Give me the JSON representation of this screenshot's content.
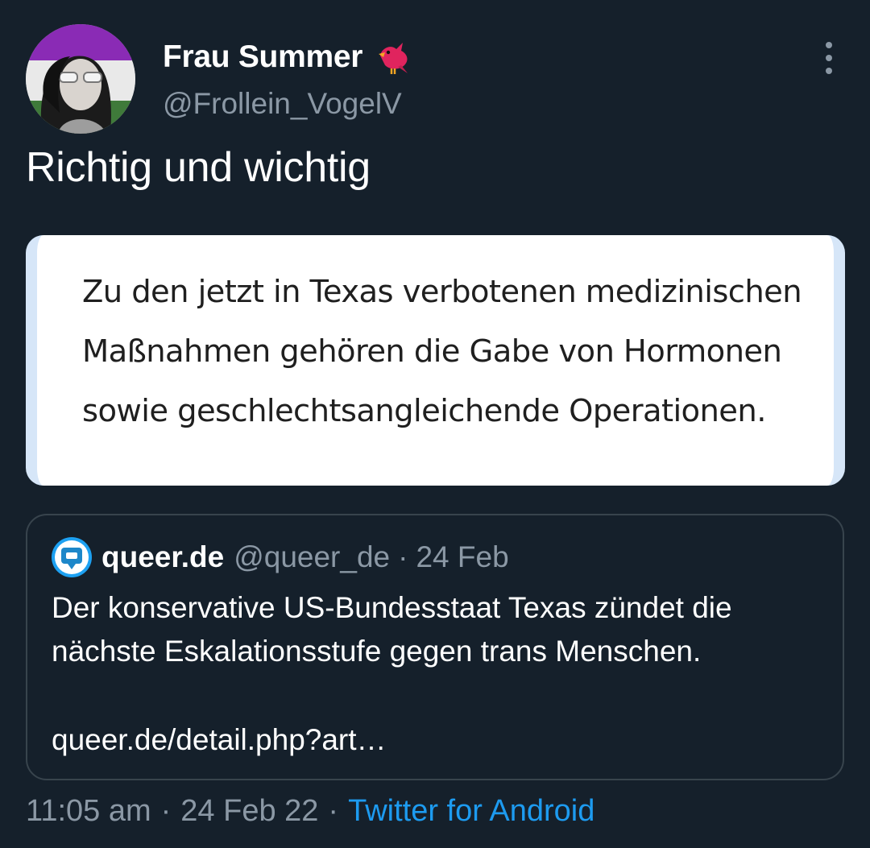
{
  "author": {
    "display_name": "Frau Summer",
    "handle": "@Frollein_VogelV",
    "badge_icon": "cardinal-bird-icon",
    "badge_color": "#e0245e"
  },
  "tweet": {
    "text": "Richtig und wichtig"
  },
  "media": {
    "lines": [
      "Zu den jetzt in Texas verbotenen medizinischen",
      "Maßnahmen gehören die Gabe von Hormonen",
      "sowie geschlechtsangleichende Operationen."
    ]
  },
  "quote": {
    "name": "queer.de",
    "handle": "@queer_de",
    "separator": "·",
    "date": "24 Feb",
    "lines": [
      "Der konservative US-Bundesstaat Texas zündet die",
      "nächste Eskalationsstufe gegen trans Menschen."
    ],
    "link": "queer.de/detail.php?art…"
  },
  "footer": {
    "time": "11:05 am",
    "separator": "·",
    "date": "24 Feb 22",
    "source": "Twitter for Android"
  },
  "colors": {
    "background": "#15202b",
    "muted": "#8b98a5",
    "link": "#1d9bf0",
    "border": "#38444d"
  }
}
